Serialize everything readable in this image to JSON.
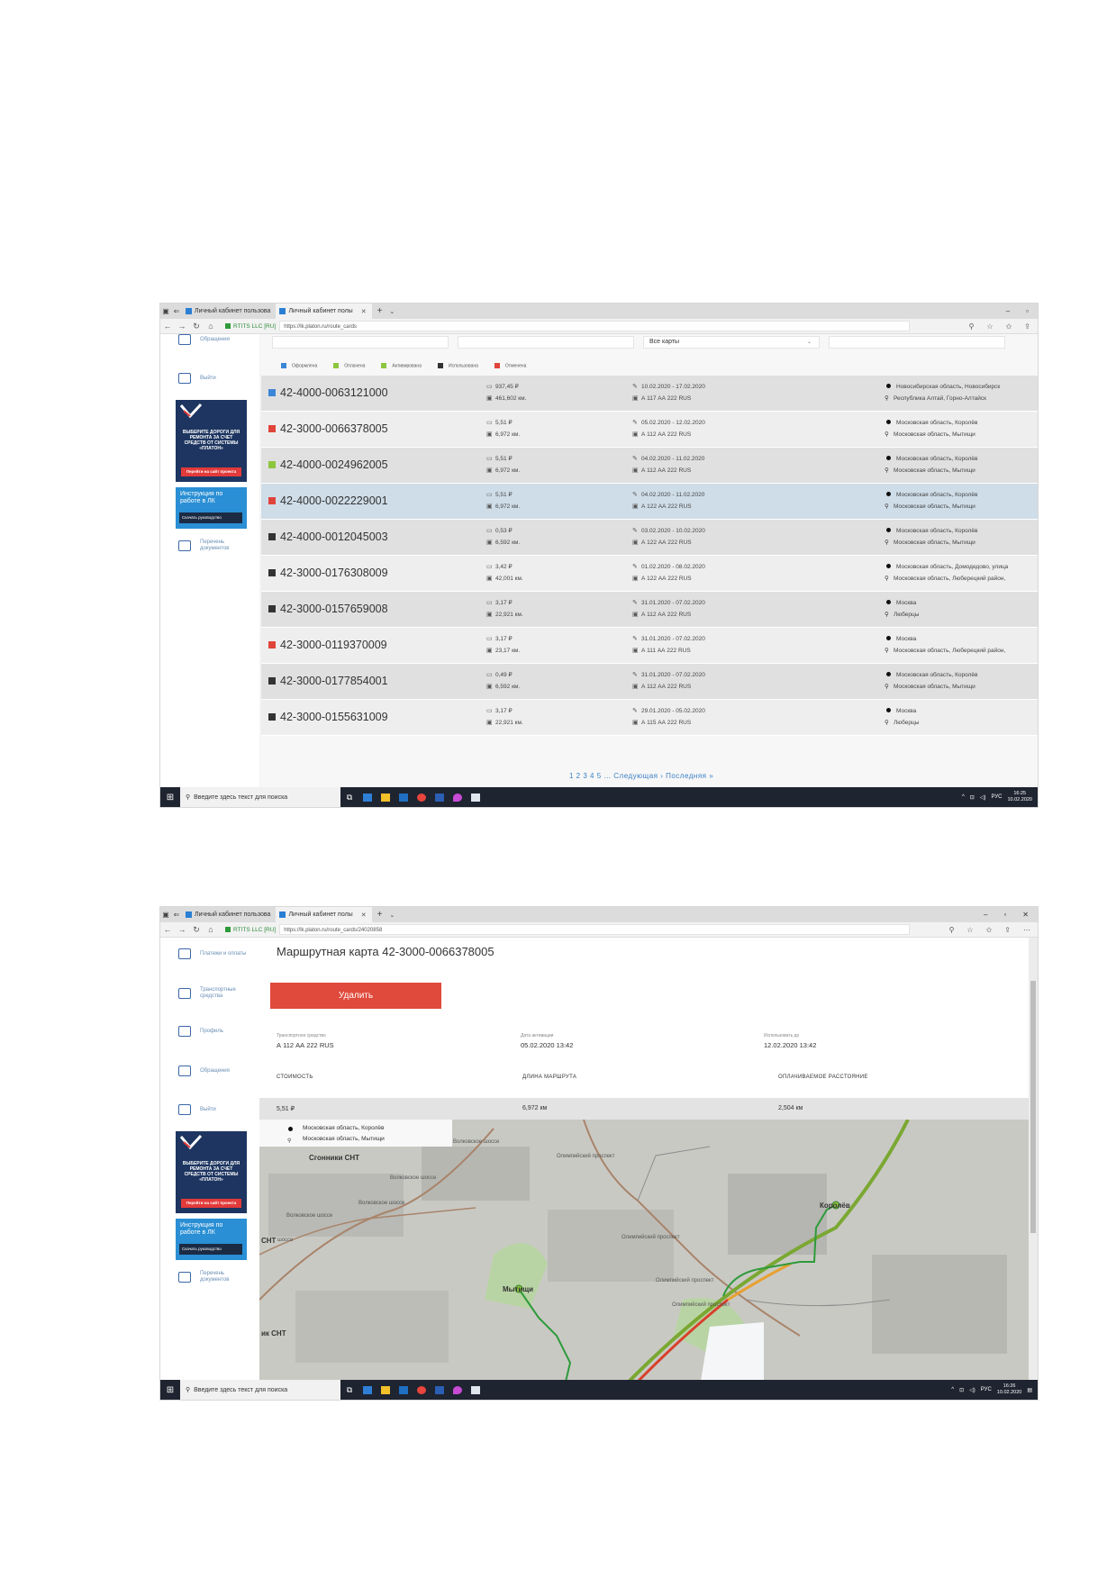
{
  "browser": {
    "tab1": "Личный кабинет пользова",
    "tab2": "Личный кабинет полы",
    "site_name": "RTITS LLC [RU]",
    "url1": "https://lk.platon.ru/route_cards",
    "url2": "https://lk.platon.ru/route_cards/24020858"
  },
  "taskbar": {
    "search_placeholder": "Введите здесь текст для поиска",
    "lang": "РУС",
    "time1": "16:25",
    "time2": "16:26",
    "date": "10.02.2020"
  },
  "sidebar": {
    "appeals": "Обращения",
    "logout": "Выйти",
    "payments": "Платежи и оплаты",
    "vehicles": "Транспортные средства",
    "profile": "Профиль",
    "documents": "Перечень документов",
    "banner_text": "ВЫБЕРИТЕ ДОРОГИ ДЛЯ РЕМОНТА ЗА СЧЕТ СРЕДСТВ ОТ СИСТЕМЫ «ПЛАТОН»",
    "banner_button": "Перейти на сайт проекта",
    "guide_title": "Инструкция по работе в ЛК",
    "guide_button": "Скачать руководство"
  },
  "list_page": {
    "filter_value": "Все карты",
    "legend": [
      "Оформлена",
      "Оплачена",
      "Активирована",
      "Использована",
      "Отменена"
    ],
    "status_colors": {
      "Оформлена": "#3b86d6",
      "Оплачена": "#8cc63f",
      "Активирована": "#8cc63f",
      "Использована": "#333333",
      "Отменена": "#e0443a"
    },
    "rows": [
      {
        "number": "42-4000-0063121000",
        "status": "Оформлена",
        "cost": "937,45 ₽",
        "distance": "461,602 км.",
        "period": "10.02.2020 - 17.02.2020",
        "vehicle": "А 117 АА 222 RUS",
        "from": "Новосибирская область, Новосибирск",
        "to": "Республика Алтай, Горно-Алтайск"
      },
      {
        "number": "42-3000-0066378005",
        "status": "Отменена",
        "cost": "5,51 ₽",
        "distance": "6,972 км.",
        "period": "05.02.2020 - 12.02.2020",
        "vehicle": "А 112 АА 222 RUS",
        "from": "Московская область, Королёв",
        "to": "Московская область, Мытищи"
      },
      {
        "number": "42-4000-0024962005",
        "status": "Активирована",
        "cost": "5,51 ₽",
        "distance": "6,972 км.",
        "period": "04.02.2020 - 11.02.2020",
        "vehicle": "А 112 АА 222 RUS",
        "from": "Московская область, Королёв",
        "to": "Московская область, Мытищи"
      },
      {
        "number": "42-4000-0022229001",
        "status": "Отменена",
        "cost": "5,51 ₽",
        "distance": "6,972 км.",
        "period": "04.02.2020 - 11.02.2020",
        "vehicle": "А 122 АА 222 RUS",
        "from": "Московская область, Королёв",
        "to": "Московская область, Мытищи"
      },
      {
        "number": "42-4000-0012045003",
        "status": "Использована",
        "cost": "0,53 ₽",
        "distance": "6,592 км.",
        "period": "03.02.2020 - 10.02.2020",
        "vehicle": "А 122 АА 222 RUS",
        "from": "Московская область, Королёв",
        "to": "Московская область, Мытищи"
      },
      {
        "number": "42-3000-0176308009",
        "status": "Использована",
        "cost": "3,42 ₽",
        "distance": "42,001 км.",
        "period": "01.02.2020 - 08.02.2020",
        "vehicle": "А 122 АА 222 RUS",
        "from": "Московская область, Домодедово, улица",
        "to": "Московская область, Люберецкий район,"
      },
      {
        "number": "42-3000-0157659008",
        "status": "Использована",
        "cost": "3,17 ₽",
        "distance": "22,921 км.",
        "period": "31.01.2020 - 07.02.2020",
        "vehicle": "А 112 АА 222 RUS",
        "from": "Москва",
        "to": "Люберцы"
      },
      {
        "number": "42-3000-0119370009",
        "status": "Отменена",
        "cost": "3,17 ₽",
        "distance": "23,17 км.",
        "period": "31.01.2020 - 07.02.2020",
        "vehicle": "А 111 АА 222 RUS",
        "from": "Москва",
        "to": "Московская область, Люберецкий район,"
      },
      {
        "number": "42-3000-0177854001",
        "status": "Использована",
        "cost": "0,49 ₽",
        "distance": "6,592 км.",
        "period": "31.01.2020 - 07.02.2020",
        "vehicle": "А 112 АА 222 RUS",
        "from": "Московская область, Королёв",
        "to": "Московская область, Мытищи"
      },
      {
        "number": "42-3000-0155631009",
        "status": "Использована",
        "cost": "3,17 ₽",
        "distance": "22,921 км.",
        "period": "29.01.2020 - 05.02.2020",
        "vehicle": "А 115 АА 222 RUS",
        "from": "Москва",
        "to": "Люберцы"
      }
    ],
    "selected_row": 3,
    "pager": "1 2 3 4 5 ... Следующая › Последняя »"
  },
  "detail_page": {
    "title": "Маршрутная карта 42-3000-0066378005",
    "delete_button": "Удалить",
    "vehicle_label": "Транспортное средство",
    "vehicle": "А 112 АА 222 RUS",
    "activation_label": "Дата активации",
    "activation": "05.02.2020 13:42",
    "valid_label": "Использовать до",
    "valid": "12.02.2020 13:42",
    "cost_head": "СТОИМОСТЬ",
    "length_head": "ДЛИНА МАРШРУТА",
    "paid_head": "ОПЛАЧИВАЕМОЕ РАССТОЯНИЕ",
    "cost": "5,51 ₽",
    "length": "6,972 км",
    "paid": "2,504 км",
    "map_from": "Московская область, Королёв",
    "map_to": "Московская область, Мытищи",
    "map_labels": {
      "sgonniki": "Сгонники СНТ",
      "volkovskoe1": "Волковское шоссе",
      "volkovskoe2": "Волковское шоссе",
      "volkovskoe3": "Волковское шоссе",
      "volkovskoe4": "Волковское шоссе",
      "olymp1": "Олимпийский проспект",
      "olymp2": "Олимпийский проспект",
      "olymp3": "Олимпийский проспект",
      "olymp4": "Олимпийский проспект",
      "mytishchi": "Мытищи",
      "korolev": "Королёв",
      "snt_left": "СНТ",
      "snt_bottom": "ик СНТ",
      "shosse_left": "шоссе"
    },
    "route_color": "#2e9b3a",
    "road_color": "#7aa832",
    "jam_color": "#d9402b"
  }
}
